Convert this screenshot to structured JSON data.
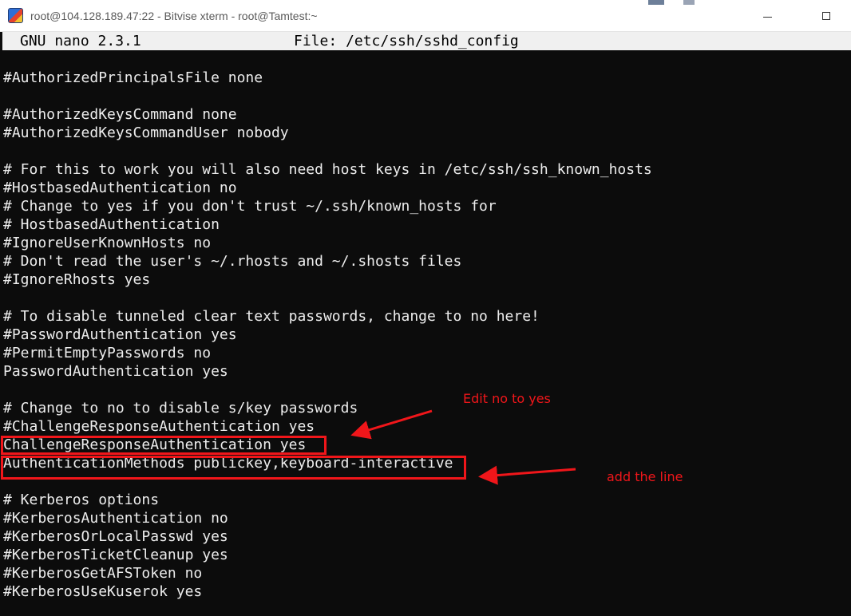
{
  "window": {
    "title": "root@104.128.189.47:22 - Bitvise xterm - root@Tamtest:~",
    "minimize_symbol": "",
    "maximize_symbol": ""
  },
  "nano": {
    "version": "GNU nano 2.3.1",
    "file": "File: /etc/ssh/sshd_config"
  },
  "lines": [
    "#AuthorizedPrincipalsFile none",
    "",
    "#AuthorizedKeysCommand none",
    "#AuthorizedKeysCommandUser nobody",
    "",
    "# For this to work you will also need host keys in /etc/ssh/ssh_known_hosts",
    "#HostbasedAuthentication no",
    "# Change to yes if you don't trust ~/.ssh/known_hosts for",
    "# HostbasedAuthentication",
    "#IgnoreUserKnownHosts no",
    "# Don't read the user's ~/.rhosts and ~/.shosts files",
    "#IgnoreRhosts yes",
    "",
    "# To disable tunneled clear text passwords, change to no here!",
    "#PasswordAuthentication yes",
    "#PermitEmptyPasswords no",
    "PasswordAuthentication yes",
    "",
    "# Change to no to disable s/key passwords",
    "#ChallengeResponseAuthentication yes",
    "ChallengeResponseAuthentication yes",
    "AuthenticationMethods publickey,keyboard-interactive",
    "",
    "# Kerberos options",
    "#KerberosAuthentication no",
    "#KerberosOrLocalPasswd yes",
    "#KerberosTicketCleanup yes",
    "#KerberosGetAFSToken no",
    "#KerberosUseKuserok yes"
  ],
  "annotations": {
    "edit_note": "Edit no to yes",
    "add_note": "add the line",
    "color": "#f0161a"
  },
  "colors": {
    "terminal_bg": "#0c0c0c",
    "terminal_fg": "#ededed",
    "nano_bar_bg": "#f0f0f0"
  }
}
